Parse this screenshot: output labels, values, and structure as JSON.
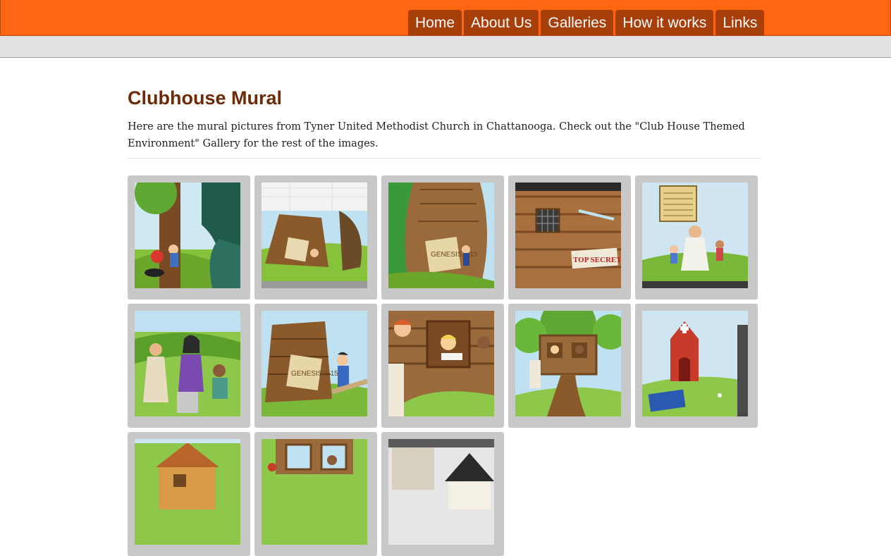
{
  "nav": {
    "items": [
      {
        "label": "Home"
      },
      {
        "label": "About Us"
      },
      {
        "label": "Galleries"
      },
      {
        "label": "How it works"
      },
      {
        "label": "Links"
      }
    ]
  },
  "main": {
    "title": "Clubhouse Mural",
    "intro": "Here are the mural pictures from Tyner United Methodist Church in Chattanooga. Check out the \"Club House Themed Environment\" Gallery for the rest of the images."
  },
  "gallery": {
    "images": [
      {
        "name": "playground-slide-mural-photo"
      },
      {
        "name": "ark-room-wide-photo"
      },
      {
        "name": "ark-curved-wall-photo",
        "text": "GENESIS 6:15"
      },
      {
        "name": "treehouse-window-photo",
        "text": "TOP SECRET!"
      },
      {
        "name": "jesus-children-mural-photo"
      },
      {
        "name": "bible-characters-mural-photo"
      },
      {
        "name": "noah-building-ark-photo",
        "text": "GENESIS 6:15"
      },
      {
        "name": "treehouse-kids-reading-photo"
      },
      {
        "name": "treehouse-tree-photo"
      },
      {
        "name": "church-mural-photo"
      },
      {
        "name": "house-mural-photo"
      },
      {
        "name": "window-mural-photo"
      },
      {
        "name": "room-corner-photo"
      }
    ]
  },
  "colors": {
    "header": "#ff6611",
    "nav_tab": "#a83e0a",
    "title": "#6e2a06",
    "subbar": "#e2e2e2",
    "thumb_frame": "#c8c8c8"
  }
}
